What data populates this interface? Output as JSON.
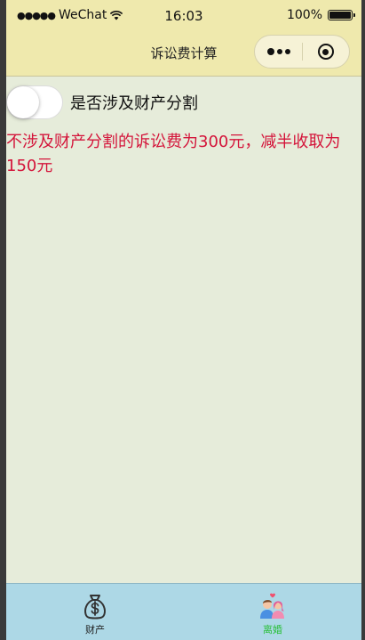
{
  "status_bar": {
    "carrier_dots": "●●●●●",
    "carrier": "WeChat",
    "time": "16:03",
    "battery": "100%"
  },
  "nav": {
    "title": "诉讼费计算"
  },
  "switch": {
    "label": "是否涉及财产分割",
    "on": false
  },
  "result": {
    "text": "不涉及财产分割的诉讼费为300元，减半收取为150元"
  },
  "tabbar": {
    "tabs": [
      {
        "label": "财产",
        "icon": "money-bag-icon",
        "active": false
      },
      {
        "label": "离婚",
        "icon": "couple-icon",
        "active": true
      }
    ]
  },
  "colors": {
    "nav_background": "#efe9ad",
    "page_background": "#e6ecda",
    "tabbar_background": "#add8e6",
    "result_text": "#d4143a",
    "tab_active": "#2bbf3a"
  }
}
